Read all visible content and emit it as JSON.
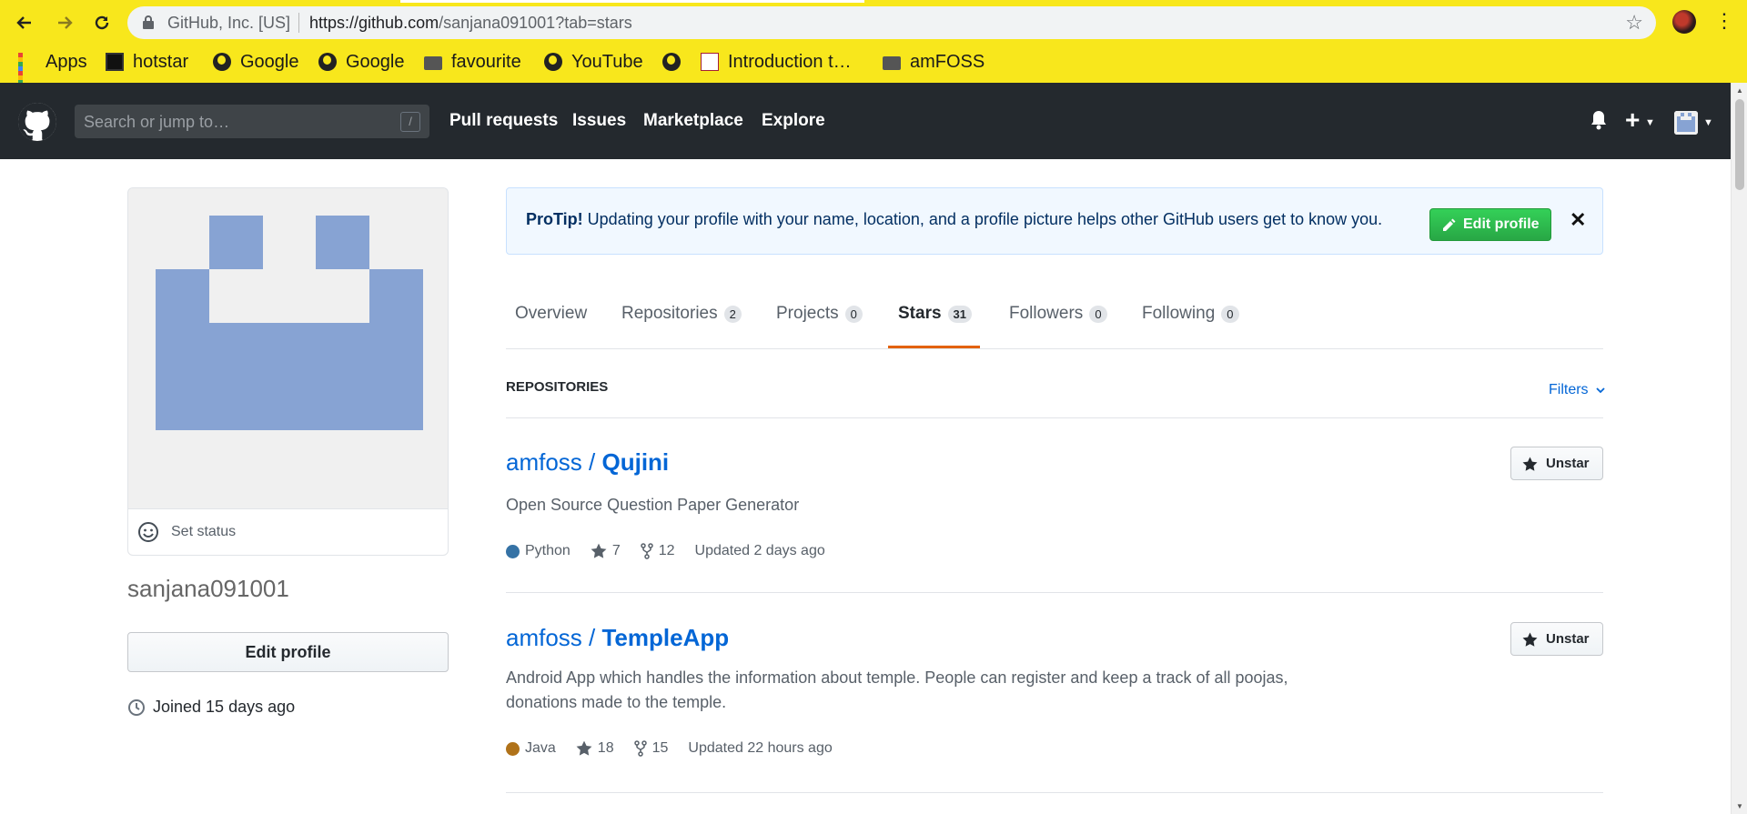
{
  "browser": {
    "site_label": "GitHub, Inc. [US]",
    "url_host": "https://github.com",
    "url_path": "/sanjana091001?tab=stars"
  },
  "bookmarks": [
    {
      "label": "Apps",
      "icon": "apps-grid-icon"
    },
    {
      "label": "hotstar",
      "icon": "hotstar-icon"
    },
    {
      "label": "Google",
      "icon": "globe-icon"
    },
    {
      "label": "Google",
      "icon": "globe-icon"
    },
    {
      "label": "favourite",
      "icon": "folder-icon"
    },
    {
      "label": "YouTube",
      "icon": "globe-icon"
    },
    {
      "label": "",
      "icon": "globe-icon"
    },
    {
      "label": "Introduction t…",
      "icon": "mit-ocw-icon"
    },
    {
      "label": "amFOSS",
      "icon": "folder-icon"
    }
  ],
  "gh_header": {
    "search_placeholder": "Search or jump to…",
    "search_shortcut": "/",
    "nav": [
      "Pull requests",
      "Issues",
      "Marketplace",
      "Explore"
    ]
  },
  "profile": {
    "set_status": "Set status",
    "username": "sanjana091001",
    "edit_profile": "Edit profile",
    "joined": "Joined 15 days ago",
    "identicon_color": "#87a3d3"
  },
  "protip": {
    "label": "ProTip!",
    "text": " Updating your profile with your name, location, and a profile picture helps other GitHub users get to know you.",
    "button": "Edit profile",
    "close": "✕"
  },
  "tabs": [
    {
      "label": "Overview",
      "count": null
    },
    {
      "label": "Repositories",
      "count": "2"
    },
    {
      "label": "Projects",
      "count": "0"
    },
    {
      "label": "Stars",
      "count": "31",
      "selected": true
    },
    {
      "label": "Followers",
      "count": "0"
    },
    {
      "label": "Following",
      "count": "0"
    }
  ],
  "repos_section": {
    "heading": "REPOSITORIES",
    "filters": "Filters"
  },
  "repos": [
    {
      "owner": "amfoss",
      "name": "Qujini",
      "description": "Open Source Question Paper Generator",
      "language": "Python",
      "language_color": "#3572A5",
      "stars": "7",
      "forks": "12",
      "updated": "Updated 2 days ago",
      "button": "Unstar"
    },
    {
      "owner": "amfoss",
      "name": "TempleApp",
      "description": "Android App which handles the information about temple. People can register and keep a track of all poojas, donations made to the temple.",
      "language": "Java",
      "language_color": "#b07219",
      "stars": "18",
      "forks": "15",
      "updated": "Updated 22 hours ago",
      "button": "Unstar"
    }
  ],
  "colors": {
    "browser_bar": "#f8e71c",
    "gh_header": "#24292e",
    "link": "#0366d6",
    "tab_accent": "#e36209",
    "green_button": "#28a745"
  }
}
